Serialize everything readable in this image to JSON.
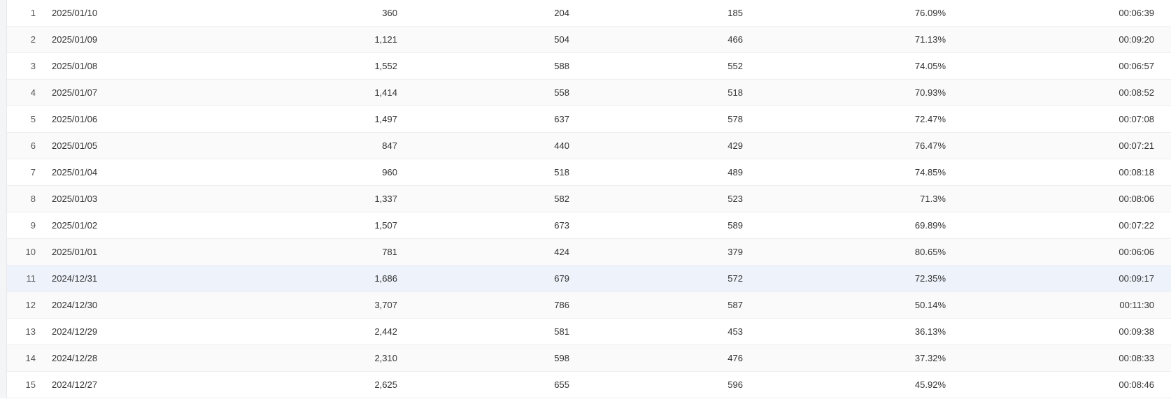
{
  "table": {
    "highlight_index": 11,
    "rows": [
      {
        "idx": "1",
        "date": "2025/01/10",
        "v1": "360",
        "v2": "204",
        "v3": "185",
        "pct": "76.09%",
        "time": "00:06:39"
      },
      {
        "idx": "2",
        "date": "2025/01/09",
        "v1": "1,121",
        "v2": "504",
        "v3": "466",
        "pct": "71.13%",
        "time": "00:09:20"
      },
      {
        "idx": "3",
        "date": "2025/01/08",
        "v1": "1,552",
        "v2": "588",
        "v3": "552",
        "pct": "74.05%",
        "time": "00:06:57"
      },
      {
        "idx": "4",
        "date": "2025/01/07",
        "v1": "1,414",
        "v2": "558",
        "v3": "518",
        "pct": "70.93%",
        "time": "00:08:52"
      },
      {
        "idx": "5",
        "date": "2025/01/06",
        "v1": "1,497",
        "v2": "637",
        "v3": "578",
        "pct": "72.47%",
        "time": "00:07:08"
      },
      {
        "idx": "6",
        "date": "2025/01/05",
        "v1": "847",
        "v2": "440",
        "v3": "429",
        "pct": "76.47%",
        "time": "00:07:21"
      },
      {
        "idx": "7",
        "date": "2025/01/04",
        "v1": "960",
        "v2": "518",
        "v3": "489",
        "pct": "74.85%",
        "time": "00:08:18"
      },
      {
        "idx": "8",
        "date": "2025/01/03",
        "v1": "1,337",
        "v2": "582",
        "v3": "523",
        "pct": "71.3%",
        "time": "00:08:06"
      },
      {
        "idx": "9",
        "date": "2025/01/02",
        "v1": "1,507",
        "v2": "673",
        "v3": "589",
        "pct": "69.89%",
        "time": "00:07:22"
      },
      {
        "idx": "10",
        "date": "2025/01/01",
        "v1": "781",
        "v2": "424",
        "v3": "379",
        "pct": "80.65%",
        "time": "00:06:06"
      },
      {
        "idx": "11",
        "date": "2024/12/31",
        "v1": "1,686",
        "v2": "679",
        "v3": "572",
        "pct": "72.35%",
        "time": "00:09:17"
      },
      {
        "idx": "12",
        "date": "2024/12/30",
        "v1": "3,707",
        "v2": "786",
        "v3": "587",
        "pct": "50.14%",
        "time": "00:11:30"
      },
      {
        "idx": "13",
        "date": "2024/12/29",
        "v1": "2,442",
        "v2": "581",
        "v3": "453",
        "pct": "36.13%",
        "time": "00:09:38"
      },
      {
        "idx": "14",
        "date": "2024/12/28",
        "v1": "2,310",
        "v2": "598",
        "v3": "476",
        "pct": "37.32%",
        "time": "00:08:33"
      },
      {
        "idx": "15",
        "date": "2024/12/27",
        "v1": "2,625",
        "v2": "655",
        "v3": "596",
        "pct": "45.92%",
        "time": "00:08:46"
      }
    ]
  }
}
